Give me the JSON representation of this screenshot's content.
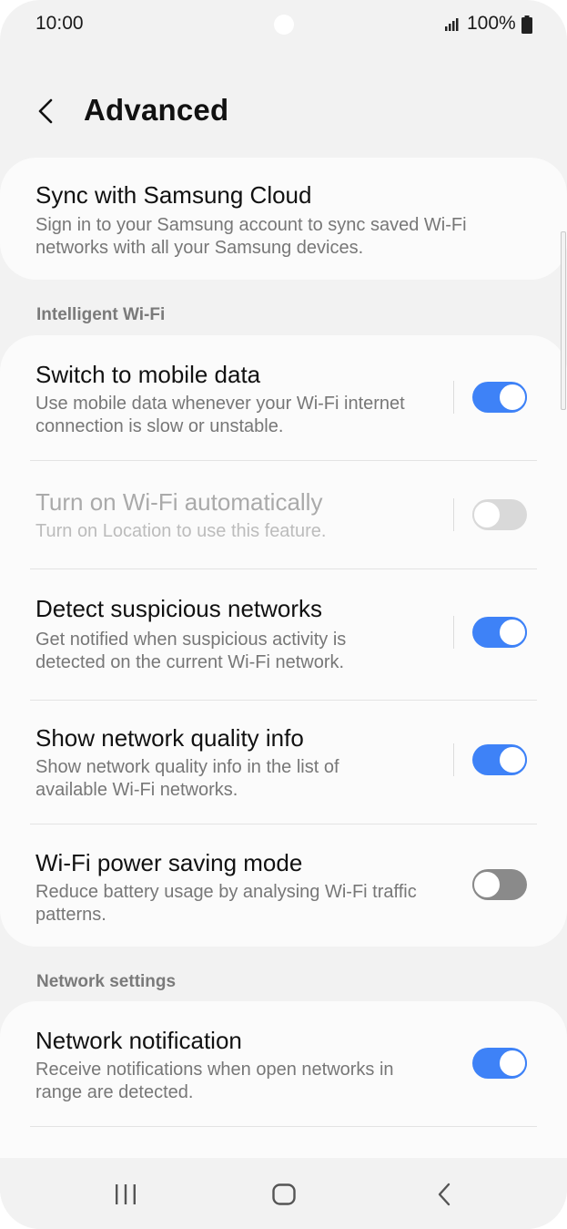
{
  "status": {
    "time": "10:00",
    "battery": "100%"
  },
  "header": {
    "title": "Advanced"
  },
  "cloud": {
    "title": "Sync with Samsung Cloud",
    "subtitle_line1": "Sign in to your Samsung account to sync saved Wi-Fi",
    "subtitle_line2": "networks with all your Samsung devices."
  },
  "sections": {
    "intelligent": "Intelligent Wi-Fi",
    "network": "Network settings"
  },
  "items": [
    {
      "title": "Switch to mobile data",
      "line1": "Use mobile data whenever your Wi-Fi internet",
      "line2": "connection is slow or unstable.",
      "state": "on"
    },
    {
      "title": "Turn on Wi-Fi automatically",
      "line1": "Turn on Location to use this feature.",
      "line2": "",
      "state": "disabled"
    },
    {
      "title": "Detect suspicious networks",
      "line1": "Get notified when suspicious activity is",
      "line2": "detected on the current Wi-Fi network.",
      "state": "on"
    },
    {
      "title": "Show network quality info",
      "line1": "Show network quality info in the list of",
      "line2": "available Wi-Fi networks.",
      "state": "on"
    },
    {
      "title": "Wi-Fi power saving mode",
      "line1": "Reduce battery usage by analysing Wi-Fi traffic",
      "line2": "patterns.",
      "state": "off"
    },
    {
      "title": "Network notification",
      "line1": "Receive notifications when open networks in",
      "line2": "range are detected.",
      "state": "on"
    }
  ],
  "colors": {
    "accent": "#3e82f7",
    "toggle_off": "#8a8a8a",
    "toggle_disabled": "#d9d9d9"
  },
  "icons": {
    "back": "chevron-left-icon",
    "recent": "recent-apps-icon",
    "home": "home-icon",
    "nav_back": "nav-back-icon"
  }
}
